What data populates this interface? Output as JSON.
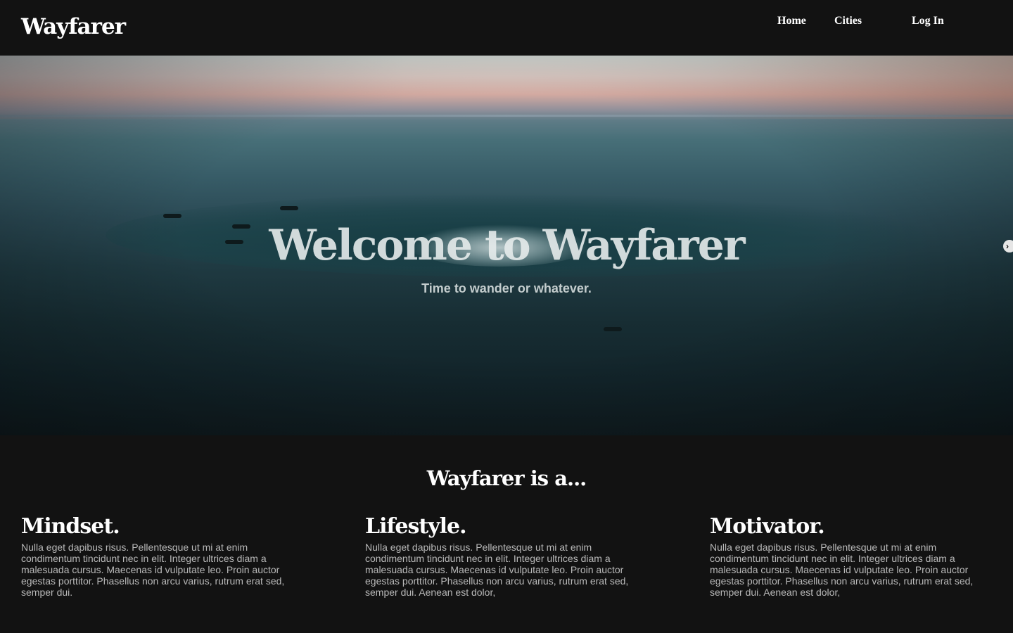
{
  "nav": {
    "brand": "Wayfarer",
    "links": [
      "Home",
      "Cities",
      "Log In"
    ]
  },
  "hero": {
    "title": "Welcome to Wayfarer",
    "subtitle": "Time to wander or whatever.",
    "next_icon": "chevron-right-icon",
    "next_glyph": "›"
  },
  "about": {
    "heading": "Wayfarer is a...",
    "features": [
      {
        "title": "Mindset.",
        "text": "Nulla eget dapibus risus. Pellentesque ut mi at enim condimentum tincidunt nec in elit. Integer ultrices diam a malesuada cursus. Maecenas id vulputate leo. Proin auctor egestas porttitor. Phasellus non arcu varius, rutrum erat sed, semper dui."
      },
      {
        "title": "Lifestyle.",
        "text": "Nulla eget dapibus risus. Pellentesque ut mi at enim condimentum tincidunt nec in elit. Integer ultrices diam a malesuada cursus. Maecenas id vulputate leo. Proin auctor egestas porttitor. Phasellus non arcu varius, rutrum erat sed, semper dui. Aenean est dolor,"
      },
      {
        "title": "Motivator.",
        "text": "Nulla eget dapibus risus. Pellentesque ut mi at enim condimentum tincidunt nec in elit. Integer ultrices diam a malesuada cursus. Maecenas id vulputate leo. Proin auctor egestas porttitor. Phasellus non arcu varius, rutrum erat sed, semper dui. Aenean est dolor,"
      }
    ]
  },
  "colors": {
    "background": "#121212",
    "text": "#ffffff",
    "muted_text": "#b9b9b9"
  }
}
